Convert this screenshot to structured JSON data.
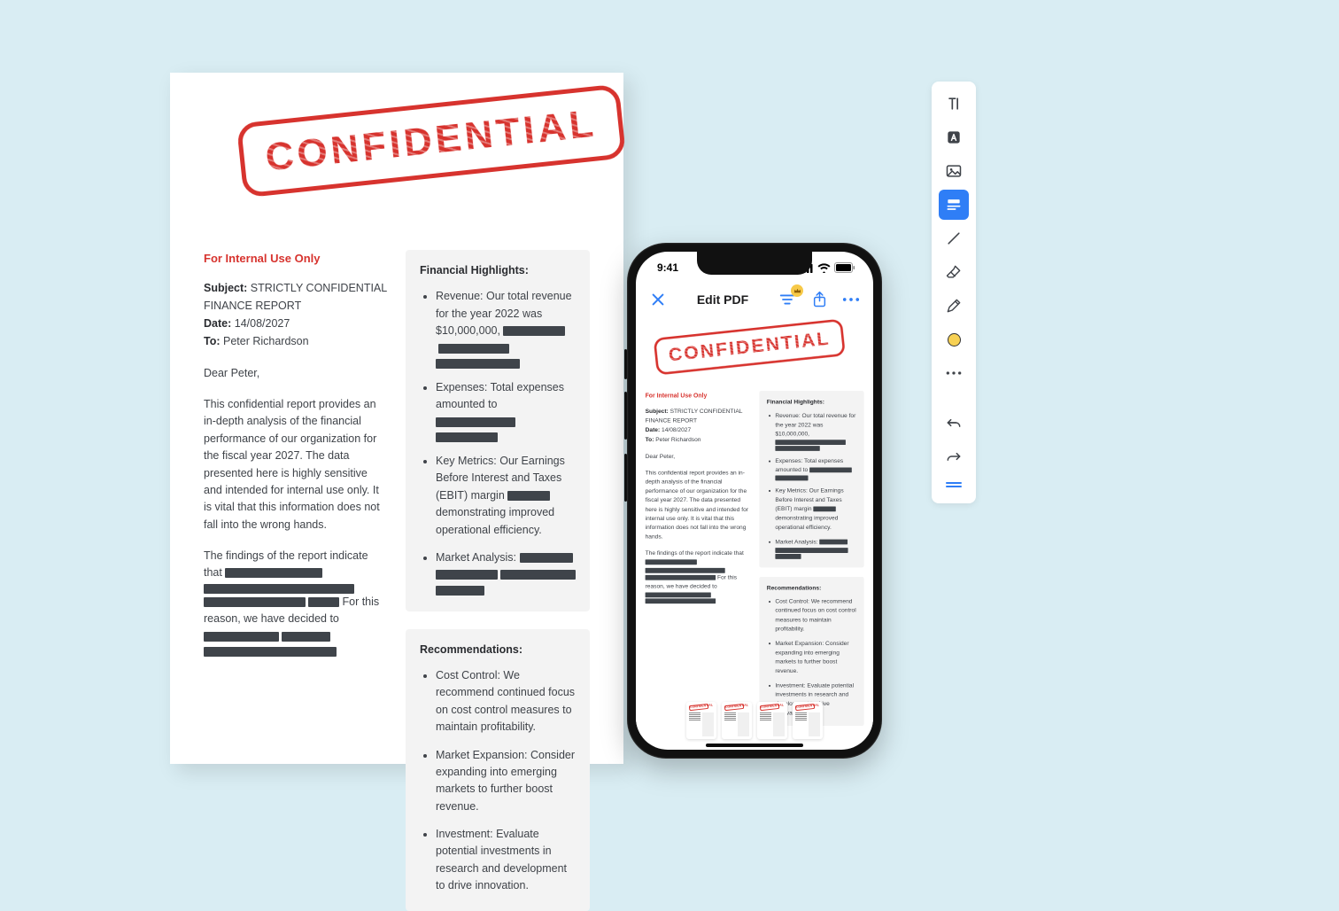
{
  "document": {
    "stamp": "CONFIDENTIAL",
    "internal_use": "For Internal Use Only",
    "subject_label": "Subject:",
    "subject_value": "STRICTLY CONFIDENTIAL FINANCE REPORT",
    "date_label": "Date:",
    "date_value": "14/08/2027",
    "to_label": "To:",
    "to_value": "Peter Richardson",
    "salutation": "Dear Peter,",
    "intro": "This confidential report provides an in-depth analysis of the financial performance of our organization for the fiscal year 2027. The data presented here is highly sensitive and intended for internal use only. It is vital that this information does not fall into the wrong hands.",
    "findings_pre": "The findings of the report indicate that",
    "findings_mid": "For this reason, we have decided to",
    "fin_heading": "Financial Highlights:",
    "fin": {
      "revenue": "Revenue: Our total revenue for the year 2022 was $10,000,000,",
      "expenses": "Expenses: Total expenses amounted to",
      "metrics_pre": "Key Metrics: Our Earnings Before Interest and Taxes (EBIT) margin",
      "metrics_post": "demonstrating improved operational efficiency.",
      "market": "Market Analysis:"
    },
    "rec_heading": "Recommendations:",
    "rec": {
      "r1": "Cost Control: We recommend continued focus on cost control measures to maintain profitability.",
      "r2": "Market Expansion: Consider expanding into emerging markets to further boost revenue.",
      "r3": "Investment: Evaluate potential investments in research and development to drive innovation."
    }
  },
  "phone": {
    "time": "9:41",
    "title": "Edit PDF",
    "thumb_label": "CONFIDENTIAL"
  },
  "toolbar": {
    "tools": [
      "text-cursor-icon",
      "highlight-text-icon",
      "image-icon",
      "redact-icon",
      "line-icon",
      "eraser-icon",
      "pen-icon",
      "color-icon",
      "more-icon",
      "undo-icon",
      "redo-icon",
      "drag-handle-icon"
    ],
    "active_index": 3
  },
  "colors": {
    "accent_blue": "#2f7ef6",
    "stamp_red": "#d7332e",
    "redact": "#3f444a",
    "bg": "#d9edf3"
  }
}
